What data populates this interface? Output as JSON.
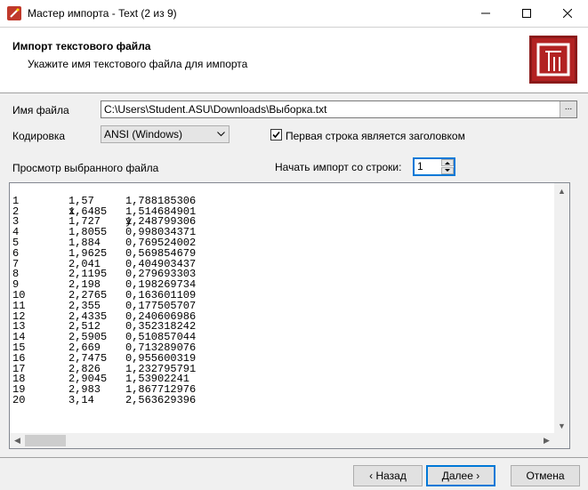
{
  "window": {
    "title": "Мастер импорта - Text (2 из 9)"
  },
  "header": {
    "title": "Импорт текстового файла",
    "subtitle": "Укажите имя текстового файла для импорта"
  },
  "form": {
    "file_label": "Имя файла",
    "file_value": "C:\\Users\\Student.ASU\\Downloads\\Выборка.txt",
    "browse_label": "...",
    "encoding_label": "Кодировка",
    "encoding_value": "ANSI (Windows)",
    "first_row_header_label": "Первая строка является заголовком",
    "first_row_header_checked": true,
    "preview_label": "Просмотр выбранного файла",
    "start_row_label": "Начать импорт со строки:",
    "start_row_value": "1"
  },
  "preview": {
    "header": [
      "",
      "x",
      "y"
    ],
    "rows": [
      [
        "1",
        "1,57",
        "1,788185306"
      ],
      [
        "2",
        "1,6485",
        "1,514684901"
      ],
      [
        "3",
        "1,727",
        "1,248799306"
      ],
      [
        "4",
        "1,8055",
        "0,998034371"
      ],
      [
        "5",
        "1,884",
        "0,769524002"
      ],
      [
        "6",
        "1,9625",
        "0,569854679"
      ],
      [
        "7",
        "2,041",
        "0,404903437"
      ],
      [
        "8",
        "2,1195",
        "0,279693303"
      ],
      [
        "9",
        "2,198",
        "0,198269734"
      ],
      [
        "10",
        "2,2765",
        "0,163601109"
      ],
      [
        "11",
        "2,355",
        "0,177505707"
      ],
      [
        "12",
        "2,4335",
        "0,240606986"
      ],
      [
        "13",
        "2,512",
        "0,352318242"
      ],
      [
        "14",
        "2,5905",
        "0,510857044"
      ],
      [
        "15",
        "2,669",
        "0,713289076"
      ],
      [
        "16",
        "2,7475",
        "0,955600319"
      ],
      [
        "17",
        "2,826",
        "1,232795791"
      ],
      [
        "18",
        "2,9045",
        "1,53902241"
      ],
      [
        "19",
        "2,983",
        "1,867712976"
      ],
      [
        "20",
        "3,14",
        "2,563629396"
      ]
    ]
  },
  "buttons": {
    "back": "‹ Назад",
    "next": "Далее ›",
    "cancel": "Отмена"
  },
  "icons": {
    "app": "wand-icon",
    "logo": "import-wizard-icon"
  }
}
